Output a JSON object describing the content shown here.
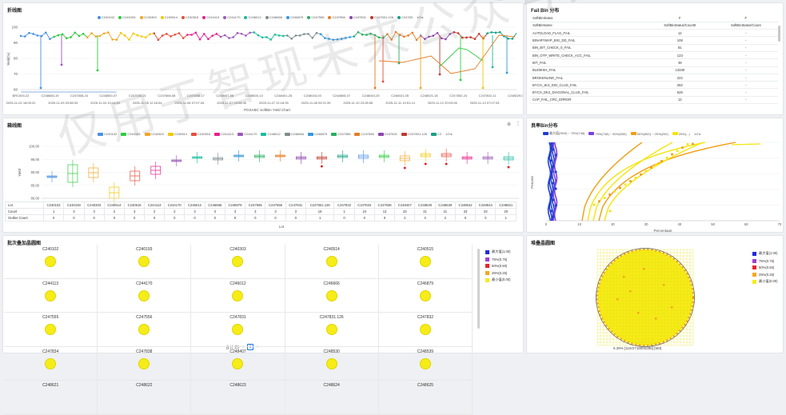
{
  "panels": {
    "trend_title": "折线图",
    "fail_title": "Fail Bin 分布",
    "box_title": "箱线图",
    "cum_title": "良率Bin分布",
    "lotmap_title": "批次叠加晶圆图",
    "stack_title": "堆叠晶圆图"
  },
  "trend": {
    "legend": [
      "C240102",
      "C240193",
      "C240303",
      "C240514",
      "C240515",
      "C244113",
      "C244170",
      "C246012",
      "C246666",
      "C246879",
      "C247555",
      "C247556",
      "C247831",
      "C247831.126",
      "C24783"
    ],
    "legend_colors": [
      "#4a90e2",
      "#2ecc40",
      "#f5a623",
      "#f0c808",
      "#e74c3c",
      "#e91e8c",
      "#9b59b6",
      "#1abc9c",
      "#7f8c8d",
      "#3498db",
      "#27ae60",
      "#e67e22",
      "#8e44ad",
      "#c0392b",
      "#16a085"
    ],
    "pager": "1/2",
    "ylabel": "Yield(%)",
    "yticks": [
      "100",
      "90",
      "80",
      "70",
      "60"
    ],
    "xlabel": "PGSABC SoftBin Yield Chart",
    "xticks_top": [
      "BRC000-22",
      "C248665-19",
      "C247808-24",
      "C248500-07",
      "C247030-21",
      "C247808-08",
      "C247838-17",
      "C248407-08",
      "C248500-13",
      "C248401-25",
      "C248043-03",
      "C248805-07",
      "C248043-20",
      "C248021-05",
      "C248021-18",
      "C247802-24",
      "C247802-11",
      "C248029-03"
    ],
    "xticks_bottom": [
      "2025-11-01 18:05:31",
      "2025-11-03 03:58:33",
      "2025-11-04 10:14:40",
      "2025-11-05 12:16:54",
      "2025-11-06 07:07:28",
      "2025-11-07 03:08:40",
      "2025-11-07 22:18:39",
      "2025-11-08 09:21:39",
      "2025-11-10 23:28:55",
      "2025-11-11 10:51:14",
      "2025-11-12 20:03:06",
      "2025-11-13 07:07:03"
    ]
  },
  "fail_bins": {
    "head1": [
      "SoftBinStatus",
      "F",
      "F"
    ],
    "head2": [
      "SoftBinName",
      "SoftBinStatus/Count0",
      "SoftBinStatus/Count"
    ],
    "rows": [
      {
        "name": "AUTOLOAD_FLAG_FAIL",
        "v1": "12",
        "v2": "-"
      },
      {
        "name": "BINARYMAP_BIG_DD_FAIL",
        "v1": "108",
        "v2": "-"
      },
      {
        "name": "BIN_BIT_CHECK_0_FAIL",
        "v1": "81",
        "v2": "-"
      },
      {
        "name": "BIN_OTP_WRITE_CHECK_ACC_FAIL",
        "v1": "123",
        "v2": "-"
      },
      {
        "name": "BIT_FAIL",
        "v1": "39",
        "v2": "-"
      },
      {
        "name": "BLEMISH_FAIL",
        "v1": "13330",
        "v2": "-"
      },
      {
        "name": "BROKENLINE_FAIL",
        "v1": "222",
        "v2": "-"
      },
      {
        "name": "BYCH_1K2_DIO_CLUS_FAIL",
        "v1": "282",
        "v2": "-"
      },
      {
        "name": "BYCH_DK2_DIAGONAL_CLUS_FAIL",
        "v1": "626",
        "v2": "-"
      },
      {
        "name": "CAP_FAIL_CRC_ERROR",
        "v1": "12",
        "v2": "-"
      }
    ]
  },
  "box": {
    "legend": [
      "C240102",
      "C240193",
      "C240303",
      "C240514",
      "C240515",
      "C244113",
      "C244170",
      "C246012",
      "C246666",
      "C246879",
      "C247555",
      "C247556",
      "C247831",
      "C247831.126",
      "C2"
    ],
    "pager": "1/2",
    "ylabel": "Yield",
    "yticks": [
      "100.00",
      "95.00",
      "90.00",
      "85.00",
      "80.00"
    ],
    "xlabel": "Lot",
    "table": {
      "row_labels": [
        "Lot",
        "Count",
        "Outlier Count"
      ],
      "lots": [
        "C240102",
        "C240193",
        "C240303",
        "C240514",
        "C240515",
        "C244113",
        "C244170",
        "C246012",
        "C246666",
        "C246879",
        "C247555",
        "C247556",
        "C247831",
        "C247831.126",
        "C247832",
        "C247834",
        "C247838",
        "C248407",
        "C248530",
        "C248539",
        "C248542",
        "C248543",
        "C248621"
      ],
      "counts": [
        "1",
        "3",
        "3",
        "2",
        "3",
        "2",
        "2",
        "3",
        "3",
        "3",
        "3",
        "3",
        "3",
        "16",
        "1",
        "24",
        "13",
        "23",
        "21",
        "21",
        "23",
        "23",
        "20"
      ],
      "outliers": [
        "0",
        "0",
        "0",
        "0",
        "0",
        "0",
        "0",
        "0",
        "0",
        "0",
        "0",
        "0",
        "0",
        "1",
        "0",
        "0",
        "0",
        "2",
        "3",
        "2",
        "0",
        "0",
        "1"
      ]
    }
  },
  "cum": {
    "legend": [
      "最大值(99/0) ~ 75%(748)",
      "75%(748) ~ 50%(500)",
      "50%(500) ~ 25%(252)",
      "25%(...)"
    ],
    "legend_colors": [
      "#1f3fd0",
      "#7b3fe4",
      "#f39c12",
      "#f4e50c"
    ],
    "pager": "1/2",
    "ylabel": "Percent",
    "xlabel": "Percentage",
    "xticks": [
      "0",
      "10",
      "20",
      "30",
      "40",
      "50",
      "60",
      "70"
    ],
    "yticks": [
      "100",
      "80",
      "60",
      "40",
      "20",
      "0"
    ]
  },
  "lot_maps": {
    "lots": [
      "C240102",
      "C240193",
      "C240303",
      "C240514",
      "C240515",
      "C244113",
      "C244170",
      "C246012",
      "C246666",
      "C246879",
      "C247555",
      "C247556",
      "C247831",
      "C247831.126",
      "C247832",
      "C247834",
      "C247838",
      "C248407",
      "C248530",
      "C248539",
      "C248621",
      "C248622",
      "C248623",
      "C248624",
      "C248625"
    ],
    "legend": [
      "最大值(1.00)",
      "75%(0.75)",
      "50%(0.50)",
      "25%(0.25)",
      "最小值(0.00)"
    ],
    "legend_colors": [
      "#1f2bd8",
      "#a040d0",
      "#e8242a",
      "#f5a623",
      "#f6ec18"
    ],
    "total": "合计 23",
    "page": "1"
  },
  "stack": {
    "legend": [
      "最大值(1.00)",
      "75%(0.75)",
      "50%(0.50)",
      "25%(0.25)",
      "最小值(0.00)"
    ],
    "legend_colors": [
      "#1f2bd8",
      "#a040d0",
      "#e8242a",
      "#f5a623",
      "#f6ec18"
    ],
    "caption": "5.39%  [110/2718002286]  [5M]"
  },
  "watermark": "仅用于智现未来公众号数据模拟演示"
}
